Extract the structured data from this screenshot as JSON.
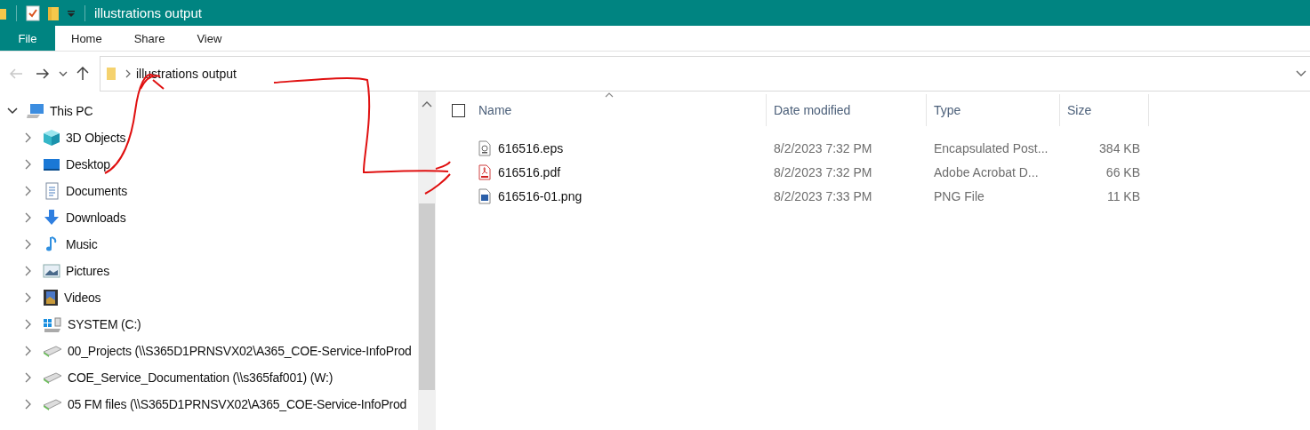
{
  "window": {
    "title": "illustrations output"
  },
  "ribbon_tabs": [
    {
      "label": "File",
      "kind": "file"
    },
    {
      "label": "Home",
      "kind": "tab"
    },
    {
      "label": "Share",
      "kind": "tab"
    },
    {
      "label": "View",
      "kind": "tab"
    }
  ],
  "navigation": {
    "back_disabled": true,
    "forward_disabled": false
  },
  "address_bar": {
    "path": [
      "illustrations output"
    ]
  },
  "sidebar": {
    "items": [
      {
        "label": "This PC",
        "expanded": true,
        "children": [
          {
            "label": "3D Objects",
            "expanded": false
          },
          {
            "label": "Desktop",
            "expanded": false
          },
          {
            "label": "Documents",
            "expanded": false
          },
          {
            "label": "Downloads",
            "expanded": false
          },
          {
            "label": "Music",
            "expanded": false
          },
          {
            "label": "Pictures",
            "expanded": false
          },
          {
            "label": "Videos",
            "expanded": false
          },
          {
            "label": "SYSTEM (C:)",
            "expanded": false
          },
          {
            "label": "00_Projects (\\\\S365D1PRNSVX02\\A365_COE-Service-InfoProd",
            "expanded": false
          },
          {
            "label": "COE_Service_Documentation (\\\\s365faf001) (W:)",
            "expanded": false
          },
          {
            "label": "05 FM files (\\\\S365D1PRNSVX02\\A365_COE-Service-InfoProd",
            "expanded": false
          }
        ]
      }
    ]
  },
  "file_list": {
    "select_all_checked": false,
    "columns": [
      {
        "label": "Name",
        "sorted": true
      },
      {
        "label": "Date modified",
        "sorted": false
      },
      {
        "label": "Type",
        "sorted": false
      },
      {
        "label": "Size",
        "sorted": false
      }
    ],
    "rows": [
      {
        "kind": "eps",
        "name": "616516.eps",
        "date_modified": "8/2/2023 7:32 PM",
        "type": "Encapsulated Post...",
        "size": "384 KB"
      },
      {
        "kind": "pdf",
        "name": "616516.pdf",
        "date_modified": "8/2/2023 7:32 PM",
        "type": "Adobe Acrobat D...",
        "size": "66 KB"
      },
      {
        "kind": "png",
        "name": "616516-01.png",
        "date_modified": "8/2/2023 7:33 PM",
        "type": "PNG File",
        "size": "11 KB"
      }
    ]
  }
}
